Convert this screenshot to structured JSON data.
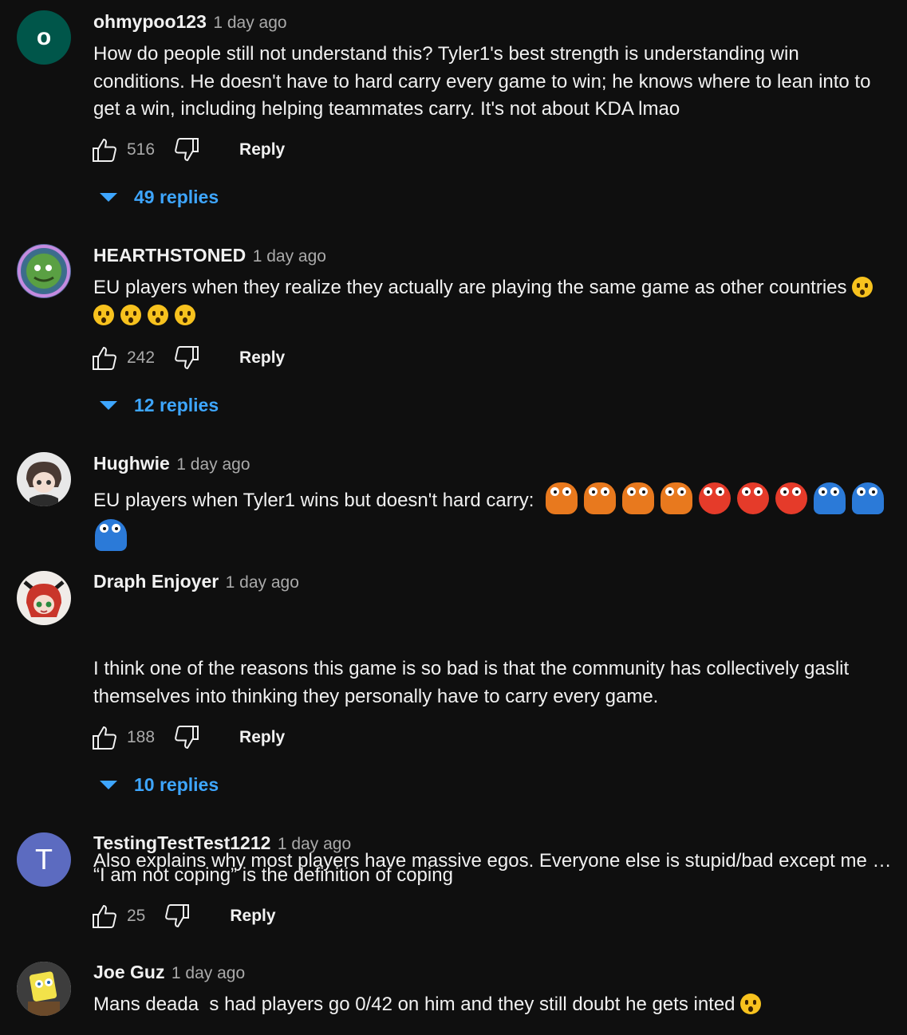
{
  "comments": [
    {
      "author": "ohmypoo123",
      "time": "1 day ago",
      "avatar_letter": "o",
      "avatar_color": "#00564a",
      "text": "How do people still not understand this? Tyler1's best strength is understanding win conditions. He doesn't have to hard carry every game to win; he knows where to lean into to get a win, including helping teammates carry. It's not about KDA lmao",
      "likes": "516",
      "reply_label": "Reply",
      "replies_label": "49 replies"
    },
    {
      "author": "HEARTHSTONED",
      "time": "1 day ago",
      "avatar_icon": "hearthstoned-logo-avatar",
      "text": "EU players when they realize they actually are playing the same game as other countries",
      "emoji_icon": "astonished-face-emoji",
      "likes": "242",
      "reply_label": "Reply",
      "replies_label": "12 replies"
    },
    {
      "author": "Hughwie",
      "time": "1 day ago",
      "avatar_icon": "anime-character-avatar",
      "text": "EU players when Tyler1 wins but doesn't hard carry:",
      "sticker_icons": [
        "orange-shock-sticker",
        "red-face-sticker",
        "blue-creature-sticker"
      ]
    },
    {
      "author": "Draph Enjoyer",
      "time": "1 day ago",
      "avatar_icon": "red-hair-anime-avatar",
      "text_line1": "I think one of the reasons this game is so bad is that the community has collectively gaslit themselves into thinking they personally have to carry every game.",
      "text_line2": "Also explains why most players have massive egos. Everyone else is stupid/bad except me o...",
      "likes": "188",
      "reply_label": "Reply",
      "replies_label": "10 replies"
    },
    {
      "author": "TestingTestTest1212",
      "time": "1 day ago",
      "avatar_letter": "T",
      "avatar_color": "#5c6bc0",
      "text": "“I am not coping” is the definition of coping",
      "likes": "25",
      "reply_label": "Reply"
    },
    {
      "author": "Joe Guz",
      "time": "1 day ago",
      "avatar_icon": "spongebob-avatar",
      "text": "Mans deada  s had players go 0/42 on him and they still doubt he gets inted",
      "emoji_icon": "tears-of-joy-emoji"
    }
  ],
  "colors": {
    "background": "#0f0f0f",
    "primary_text": "#f1f1f1",
    "secondary_text": "#aaaaaa",
    "link_blue": "#3ea6ff"
  }
}
